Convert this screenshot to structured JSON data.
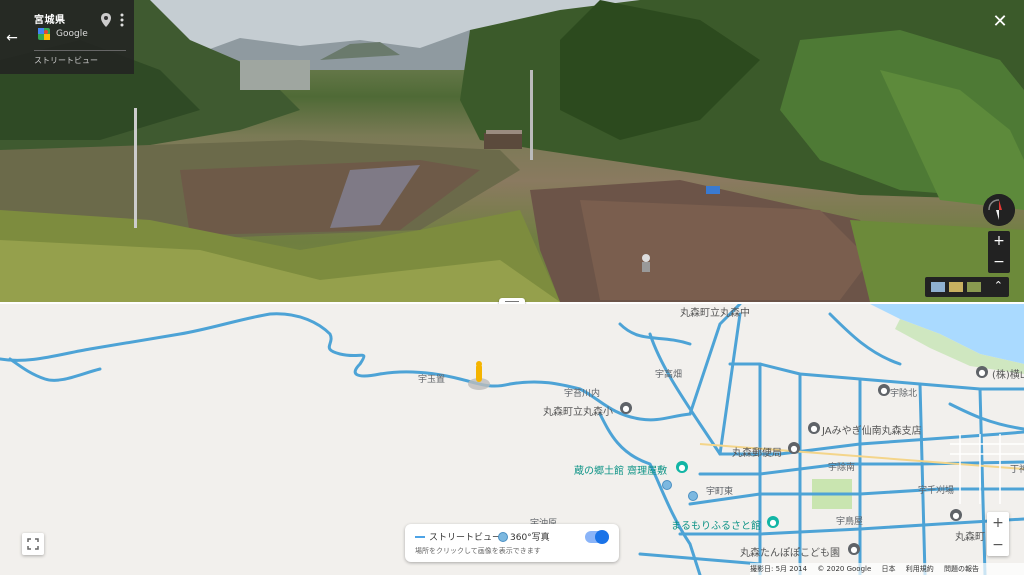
{
  "street_view": {
    "place_name": "宮城県",
    "provider": "Google",
    "mode_label": "ストリートビュー",
    "close_label": "✕",
    "zoom_in": "+",
    "zoom_out": "−"
  },
  "map": {
    "labels": {
      "area1": "宇玉置",
      "area2": "宇苔川内",
      "school": "丸森町立丸森小",
      "area3": "宇高畑",
      "jr": "丸森町立丸森中",
      "north": "宇除北",
      "ja": "JAみやぎ仙南丸森支店",
      "post": "丸森郵便局",
      "area4": "宇除南",
      "kyodo": "蔵の郷土館 齋理屋敷",
      "area5": "宇町東",
      "area6": "宇千刈場",
      "area7": "宇沖原",
      "furusato": "まるもりふるさと館",
      "area8": "宇鳥屋",
      "kodomo": "丸森たんぽぽこども園",
      "town": "丸森町 学校",
      "hospital": "(株)横山",
      "right_edge": "丁神"
    },
    "legend": {
      "street_view": "ストリートビュー",
      "photo": "360°写真",
      "hint": "場所をクリックして画像を表示できます"
    },
    "zoom_in": "+",
    "zoom_out": "−",
    "footer": {
      "date": "撮影日: 5月 2014",
      "copyright": "© 2020 Google",
      "japan": "日本",
      "terms": "利用規約",
      "feedback": "問題の報告"
    }
  },
  "colors": {
    "road_blue": "#4da3d6",
    "water": "#aadaff",
    "park": "#c9e5b0",
    "teal_poi": "#12b5a5"
  }
}
